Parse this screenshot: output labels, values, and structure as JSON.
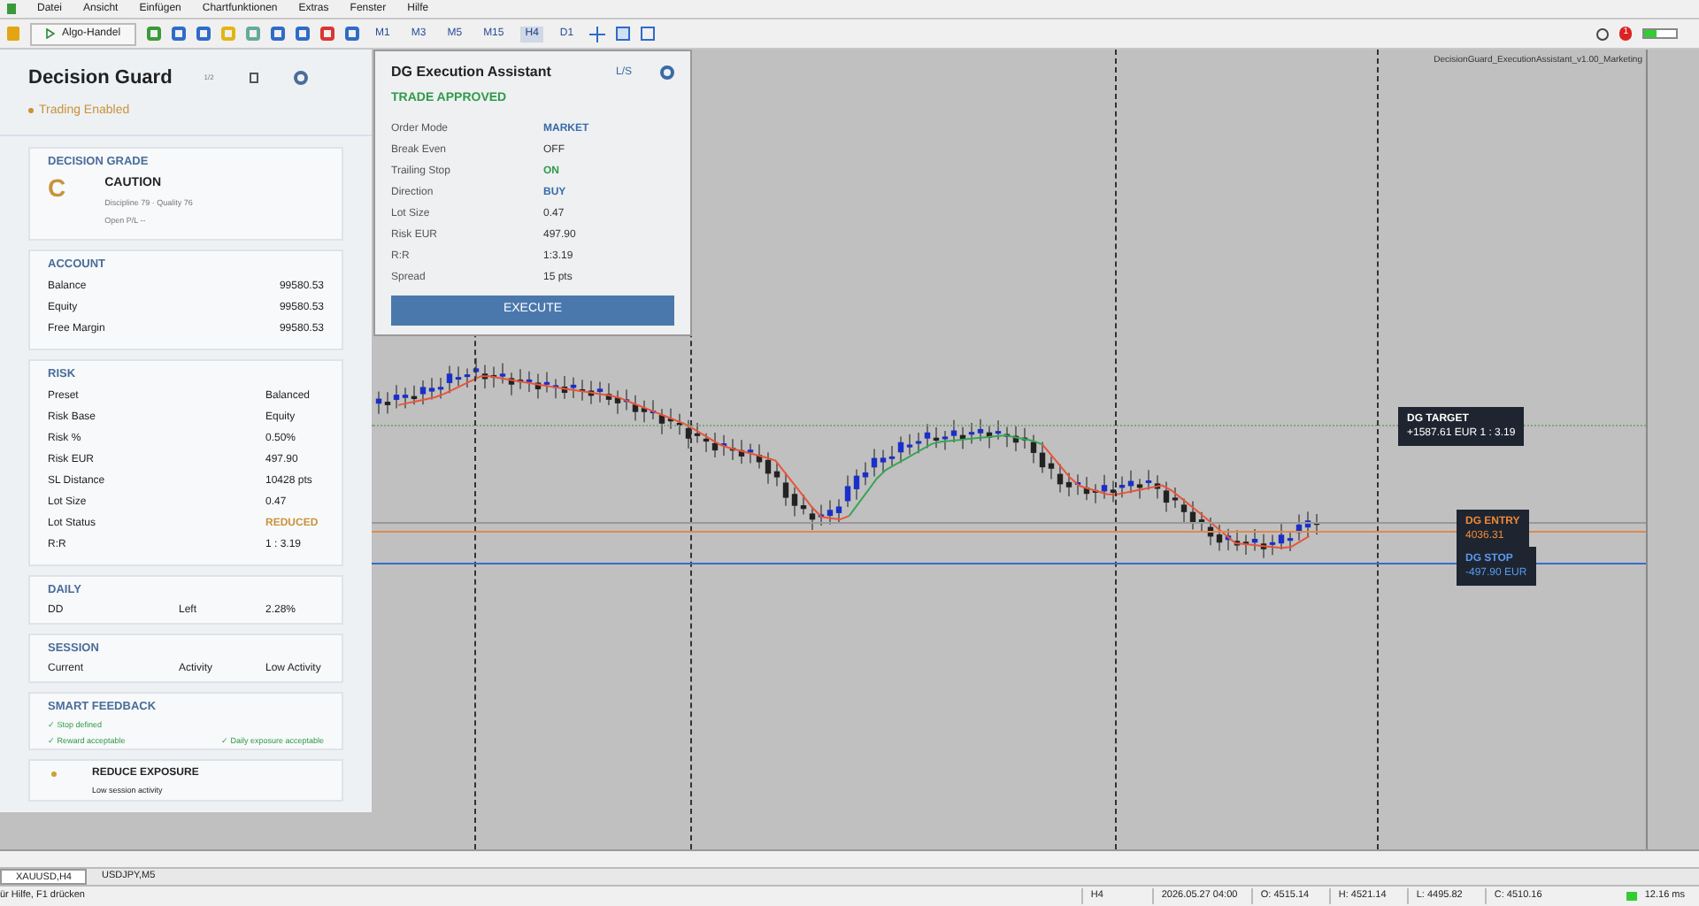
{
  "menu": [
    "Datei",
    "Ansicht",
    "Einfügen",
    "Chartfunktionen",
    "Extras",
    "Fenster",
    "Hilfe"
  ],
  "toolbar": {
    "algo_button": "Algo-Handel",
    "timeframes": [
      {
        "label": "M1",
        "selected": false
      },
      {
        "label": "M3",
        "selected": false
      },
      {
        "label": "M5",
        "selected": false
      },
      {
        "label": "M15",
        "selected": false
      },
      {
        "label": "H4",
        "selected": true
      },
      {
        "label": "D1",
        "selected": false
      }
    ],
    "notification_count": "1"
  },
  "guard": {
    "title": "Decision Guard",
    "size_label": "1/2",
    "status": "Trading Enabled",
    "grade": {
      "heading": "DECISION GRADE",
      "letter": "C",
      "label": "CAUTION",
      "scores": "Discipline 79 · Quality 76",
      "open_pl": "Open P/L  --"
    },
    "account": {
      "heading": "ACCOUNT",
      "rows": [
        {
          "label": "Balance",
          "value": "99580.53"
        },
        {
          "label": "Equity",
          "value": "99580.53"
        },
        {
          "label": "Free Margin",
          "value": "99580.53"
        }
      ]
    },
    "risk": {
      "heading": "RISK",
      "rows": [
        {
          "label": "Preset",
          "value": "Balanced",
          "kind": "plain"
        },
        {
          "label": "Risk Base",
          "value": "Equity",
          "kind": "plain"
        },
        {
          "label": "Risk %",
          "value": "0.50%",
          "kind": "plain"
        },
        {
          "label": "Risk EUR",
          "value": "497.90",
          "kind": "plain"
        },
        {
          "label": "SL Distance",
          "value": "10428 pts",
          "kind": "plain"
        },
        {
          "label": "Lot Size",
          "value": "0.47",
          "kind": "plain"
        },
        {
          "label": "Lot Status",
          "value": "REDUCED",
          "kind": "warning"
        },
        {
          "label": "R:R",
          "value": "1 : 3.19",
          "kind": "plain"
        }
      ]
    },
    "daily": {
      "heading": "DAILY",
      "cells": [
        "DD",
        "Left",
        "2.28%"
      ]
    },
    "session": {
      "heading": "SESSION",
      "cells": [
        "Current",
        "Activity",
        "Low Activity"
      ]
    },
    "feedback": {
      "heading": "SMART FEEDBACK",
      "items": [
        "✓ Stop defined",
        "✓ Reward acceptable",
        "✓ Daily exposure acceptable"
      ]
    },
    "advice": {
      "title": "REDUCE EXPOSURE",
      "detail": "Low session activity"
    }
  },
  "assistant": {
    "title": "DG Execution Assistant",
    "mode_label": "L/S",
    "status": "TRADE APPROVED",
    "rows": [
      {
        "label": "Order Mode",
        "value": "MARKET",
        "kind": "link"
      },
      {
        "label": "Break Even",
        "value": "OFF",
        "kind": "plain"
      },
      {
        "label": "Trailing Stop",
        "value": "ON",
        "kind": "good"
      },
      {
        "label": "Direction",
        "value": "BUY",
        "kind": "link"
      },
      {
        "label": "Lot Size",
        "value": "0.47",
        "kind": "plain"
      },
      {
        "label": "Risk EUR",
        "value": "497.90",
        "kind": "plain"
      },
      {
        "label": "R:R",
        "value": "1:3.19",
        "kind": "plain"
      },
      {
        "label": "Spread",
        "value": "15 pts",
        "kind": "plain"
      }
    ],
    "button": "EXECUTE"
  },
  "chart": {
    "caption": "DecisionGuard_ExecutionAssistant_v1.00_Marketing",
    "target": {
      "title": "DG TARGET",
      "detail": "+1587.61 EUR  1 : 3.19"
    },
    "entry": {
      "title": "DG ENTRY",
      "detail": "4036.31"
    },
    "stop": {
      "title": "DG STOP",
      "detail": "-497.90 EUR"
    }
  },
  "symbol_tabs": [
    {
      "label": "XAUUSD,H4",
      "selected": true
    },
    {
      "label": "USDJPY,M5",
      "selected": false
    }
  ],
  "status_bar": {
    "help": "ür Hilfe, F1 drücken",
    "timeframe": "H4",
    "time": "2026.05.27 04:00",
    "open": "O: 4515.14",
    "high": "H: 4521.14",
    "low": "L: 4495.82",
    "close": "C: 4510.16",
    "ping": "12.16 ms"
  }
}
